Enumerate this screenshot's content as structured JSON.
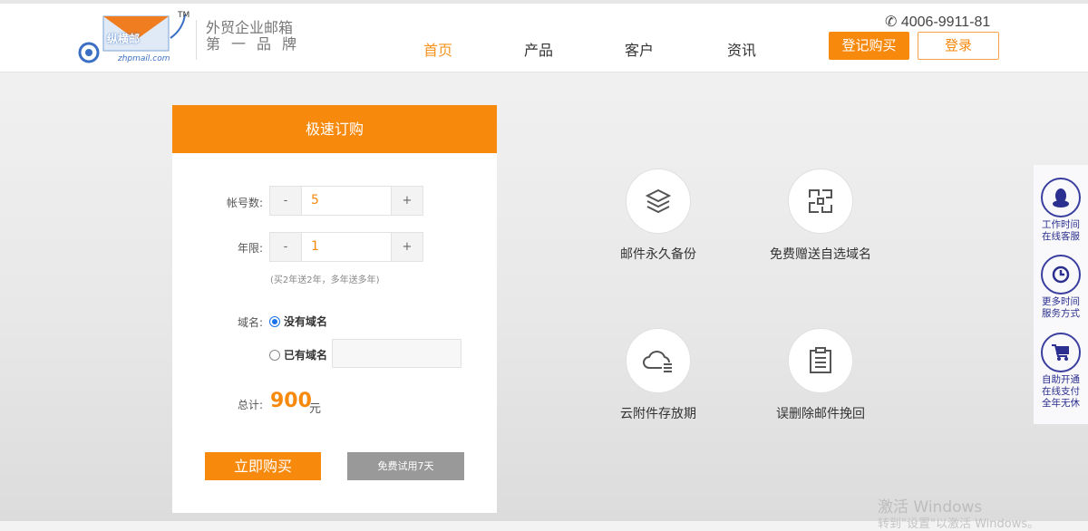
{
  "header": {
    "logo_text": "纵横邮",
    "logo_sub": "zhpmail.com",
    "logo_tm": "TM",
    "slogan_line1": "外贸企业邮箱",
    "slogan_line2": "第一品牌",
    "phone": "4006-9911-81",
    "nav": [
      {
        "label": "首页",
        "active": true
      },
      {
        "label": "产品"
      },
      {
        "label": "客户"
      },
      {
        "label": "资讯"
      }
    ],
    "register_buy": "登记购买",
    "login": "登录"
  },
  "order": {
    "title": "极速订购",
    "accounts_label": "帐号数:",
    "accounts_value": "5",
    "years_label": "年限:",
    "years_value": "1",
    "minus": "-",
    "plus": "+",
    "years_note": "(买2年送2年，多年送多年)",
    "domain_label": "域名:",
    "domain_opt1": "没有域名",
    "domain_opt2": "已有域名",
    "domain_input": "",
    "total_label": "总计:",
    "total_value": "900",
    "currency": "元",
    "buy_now": "立即购买",
    "free_trial": "免费试用7天"
  },
  "features": [
    {
      "label": "邮件永久备份",
      "icon": "layers-icon"
    },
    {
      "label": "免费赠送自选域名",
      "icon": "qr-grid-icon"
    },
    {
      "label": "云附件存放期",
      "icon": "cloud-icon"
    },
    {
      "label": "误删除邮件挽回",
      "icon": "clipboard-icon"
    }
  ],
  "sidebar": [
    {
      "l1": "工作时间",
      "l2": "在线客服"
    },
    {
      "l1": "更多时间",
      "l2": "服务方式"
    },
    {
      "l1": "自助开通",
      "l2": "在线支付",
      "l3": "全年无休"
    }
  ],
  "watermark": {
    "line1": "激活 Windows",
    "line2": "转到\"设置\"以激活 Windows。"
  }
}
